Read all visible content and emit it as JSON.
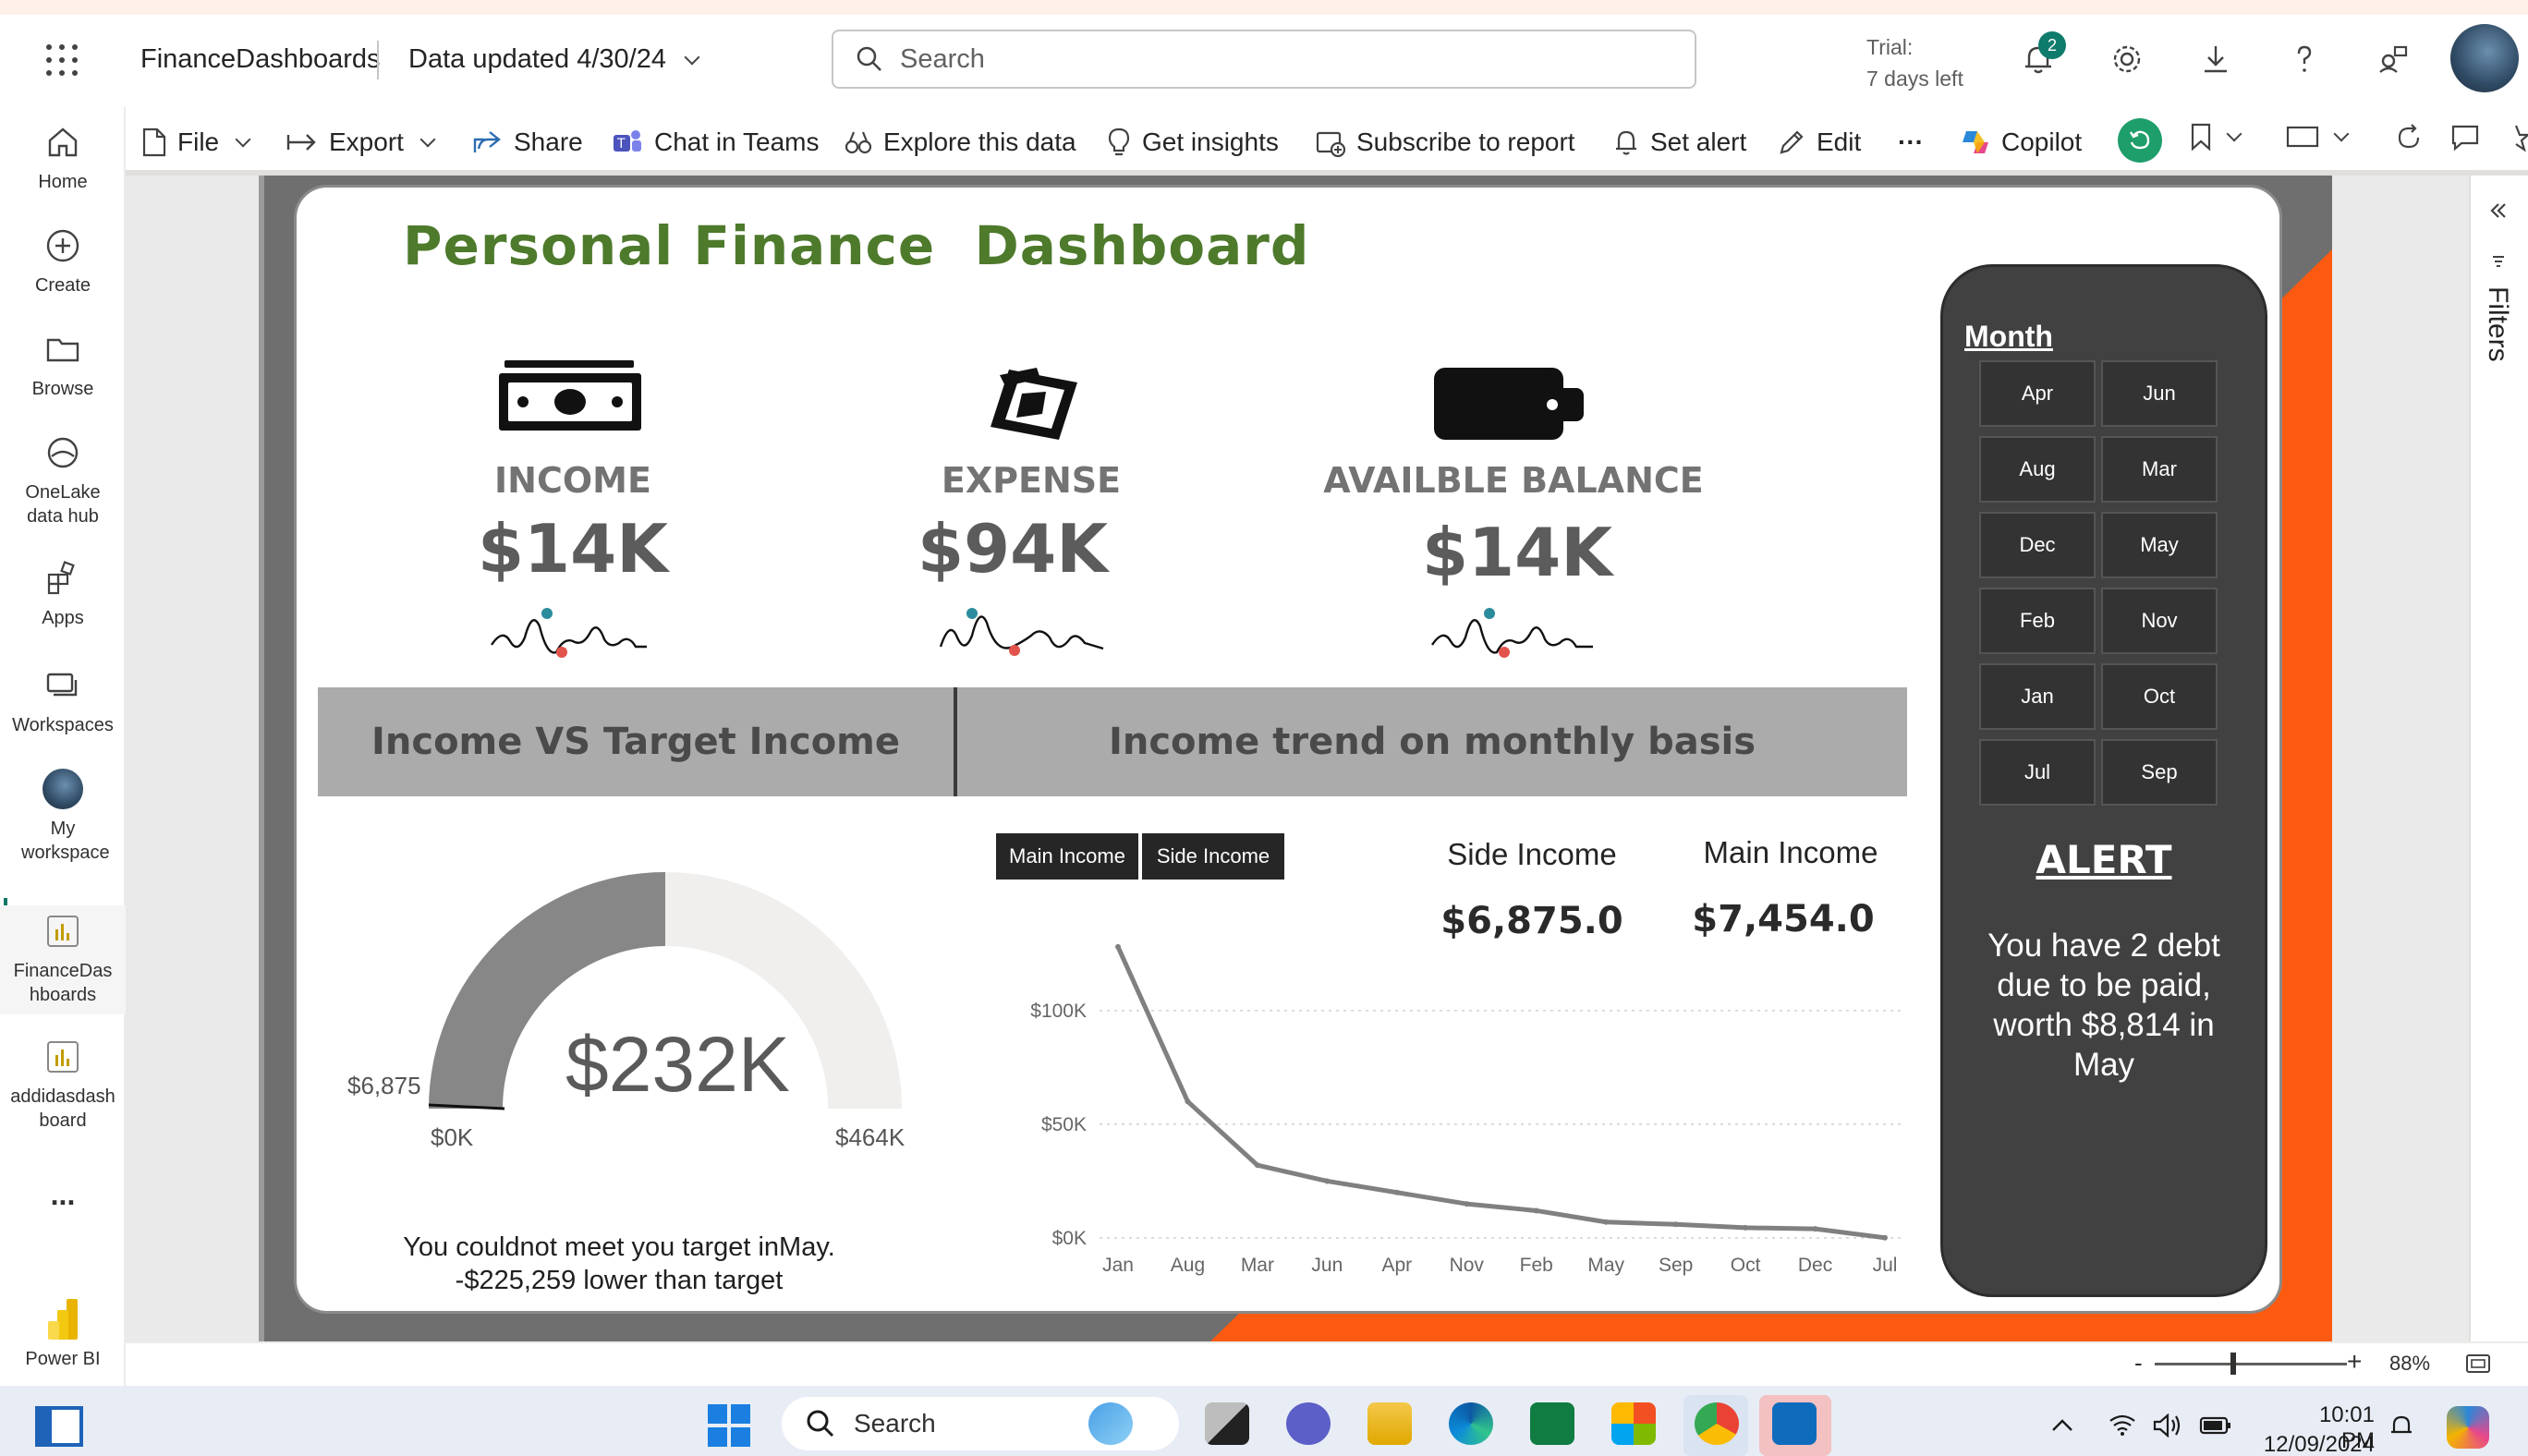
{
  "header": {
    "app_title": "FinanceDashboards",
    "data_updated": "Data updated 4/30/24",
    "search_placeholder": "Search",
    "trial_line1": "Trial:",
    "trial_line2": "7 days left",
    "notification_count": "2"
  },
  "leftrail": {
    "items": [
      {
        "label": "Home",
        "icon": "home-icon"
      },
      {
        "label": "Create",
        "icon": "plus-circle-icon"
      },
      {
        "label": "Browse",
        "icon": "folder-icon"
      },
      {
        "label": "OneLake data hub",
        "icon": "onelake-icon"
      },
      {
        "label": "Apps",
        "icon": "apps-icon"
      },
      {
        "label": "Workspaces",
        "icon": "workspaces-icon"
      },
      {
        "label": "My workspace",
        "icon": "avatar-icon"
      },
      {
        "label": "FinanceDas hboards",
        "icon": "report-icon"
      },
      {
        "label": "addidasdash board",
        "icon": "report-icon"
      },
      {
        "label": "...",
        "icon": "more-icon"
      },
      {
        "label": "Power BI",
        "icon": "powerbi-logo-icon"
      }
    ]
  },
  "toolbar": {
    "file": "File",
    "export": "Export",
    "share": "Share",
    "chat_in_teams": "Chat in Teams",
    "explore": "Explore this data",
    "insights": "Get insights",
    "subscribe": "Subscribe to report",
    "set_alert": "Set alert",
    "edit": "Edit",
    "more": "···",
    "copilot": "Copilot"
  },
  "report": {
    "title": "Personal Finance  Dashboard",
    "kpis": [
      {
        "label": "INCOME",
        "value": "$14K"
      },
      {
        "label": "EXPENSE",
        "value": "$94K"
      },
      {
        "label": "AVAILBLE BALANCE",
        "value": "$14K"
      }
    ],
    "band_left": "Income VS Target Income",
    "band_right": "Income trend on monthly basis",
    "gauge": {
      "center_value": "$232K",
      "min_label": "$0K",
      "max_label": "$464K",
      "actual_label": "$6,875",
      "value": 232,
      "max": 464,
      "actual": 6.875,
      "message_line1": "You couldnot meet you target inMay.",
      "message_line2": "-$225,259 lower than target"
    },
    "tabs": {
      "main": "Main Income",
      "side": "Side Income"
    },
    "stats": {
      "side_label": "Side Income",
      "side_value": "$6,875.0",
      "main_label": "Main Income",
      "main_value": "$7,454.0"
    },
    "slicer": {
      "title": "Month",
      "months": [
        "Apr",
        "Jun",
        "Aug",
        "Mar",
        "Dec",
        "May",
        "Feb",
        "Nov",
        "Jan",
        "Oct",
        "Jul",
        "Sep"
      ]
    },
    "alert": {
      "title": "ALERT",
      "message": "You have 2 debt due to be paid, worth $8,814 in May"
    }
  },
  "chart_data": {
    "type": "line",
    "categories": [
      "Jan",
      "Aug",
      "Mar",
      "Jun",
      "Apr",
      "Nov",
      "Feb",
      "May",
      "Sep",
      "Oct",
      "Dec",
      "Jul"
    ],
    "series": [
      {
        "values": [
          128000,
          60000,
          32000,
          25000,
          20000,
          15000,
          12000,
          7000,
          6000,
          4500,
          4000,
          100
        ]
      }
    ],
    "yticks": [
      "$0K",
      "$50K",
      "$100K"
    ],
    "ytick_values": [
      0,
      50000,
      100000
    ],
    "ylim": [
      0,
      130000
    ],
    "grid": true,
    "line_color": "#808080"
  },
  "filters": {
    "label": "Filters"
  },
  "status": {
    "zoom": "88%",
    "zoom_minus": "-",
    "zoom_plus": "+"
  },
  "taskbar": {
    "search_placeholder": "Search",
    "time": "10:01 PM",
    "date": "12/09/2024"
  },
  "colors": {
    "title_green": "#4e7a2c",
    "orange": "#fb5a10",
    "panel_dark": "#414141",
    "teal": "#117865"
  }
}
